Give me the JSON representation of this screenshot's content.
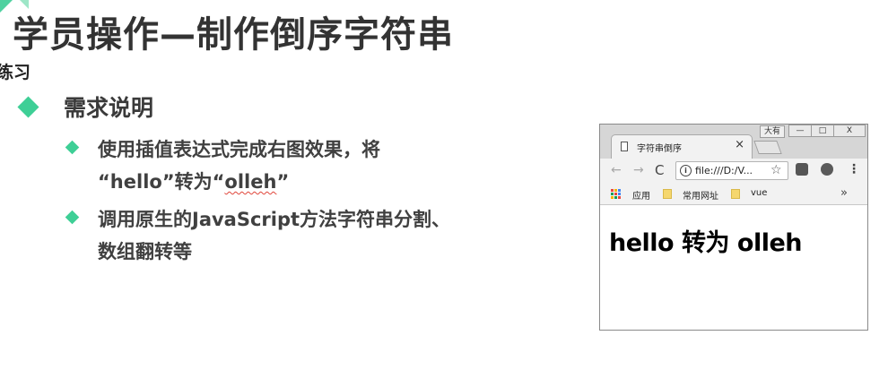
{
  "slide": {
    "title": "学员操作—制作倒序字符串",
    "section_label": "练习",
    "bullet1": "需求说明",
    "sub1_line1": "使用插值表达式完成右图效果，将",
    "sub1_line2_open": "“hello”转为“",
    "sub1_line2_word": "olleh",
    "sub1_line2_close": "”",
    "sub2_line1": "调用原生的JavaScript方法字符串分割、",
    "sub2_line2": "数组翻转等"
  },
  "browser": {
    "profile_label": "大有",
    "window_buttons": {
      "minimize": "—",
      "maximize": "□",
      "close": "X"
    },
    "tab": {
      "title": "字符串倒序",
      "close": "×"
    },
    "toolbar": {
      "back": "←",
      "forward": "→",
      "reload": "C",
      "info": "i",
      "url": "file:///D:/V...",
      "star": "☆",
      "menu": "⋮"
    },
    "bookmarks": {
      "apps_label": "应用",
      "items": [
        "常用网址",
        "vue"
      ],
      "more": "»"
    },
    "page": {
      "heading": "hello 转为 olleh"
    }
  },
  "colors": {
    "accent": "#3ecf96",
    "title_text": "#333333",
    "squiggle": "#e0453a"
  },
  "icons": {
    "bullet": "diamond",
    "tab": "document-icon",
    "apps": "grid-icon",
    "bookmark": "folder-icon"
  }
}
